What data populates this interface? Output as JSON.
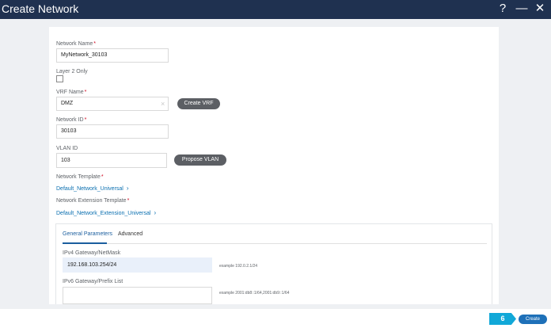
{
  "window": {
    "title": "Create Network",
    "help_icon": "?",
    "minimize_icon": "—",
    "close_icon": "✕"
  },
  "form": {
    "network_name": {
      "label": "Network Name",
      "required": "*",
      "value": "MyNetwork_30103"
    },
    "layer2_only": {
      "label": "Layer 2 Only",
      "checked": false
    },
    "vrf_name": {
      "label": "VRF Name",
      "required": "*",
      "value": "DMZ",
      "clear_icon": "×",
      "chevron_icon": "∨",
      "create_button": "Create VRF"
    },
    "network_id": {
      "label": "Network ID",
      "required": "*",
      "value": "30103"
    },
    "vlan_id": {
      "label": "VLAN ID",
      "value": "103",
      "propose_button": "Propose VLAN"
    },
    "network_template": {
      "label": "Network Template",
      "required": "*",
      "value": "Default_Network_Universal",
      "chevron_icon": "›"
    },
    "network_extension_template": {
      "label": "Network Extension Template",
      "required": "*",
      "value": "Default_Network_Extension_Universal",
      "chevron_icon": "›"
    }
  },
  "tabs": [
    {
      "label": "General Parameters",
      "active": true
    },
    {
      "label": "Advanced",
      "active": false
    }
  ],
  "general": {
    "ipv4": {
      "label": "IPv4 Gateway/NetMask",
      "value": "192.168.103.254/24",
      "example": "example 192.0.2.1/24"
    },
    "ipv6": {
      "label": "IPv6 Gateway/Prefix List",
      "value": "",
      "example": "example 2001:db8::1/64,2001:db9::1/64"
    }
  },
  "footer": {
    "step": "6",
    "create_button": "Create"
  },
  "colors": {
    "titlebar": "#1f3150",
    "accent": "#1e70b8",
    "step_badge": "#11a8d8",
    "required": "#d0021b",
    "link": "#0a6fb0"
  }
}
